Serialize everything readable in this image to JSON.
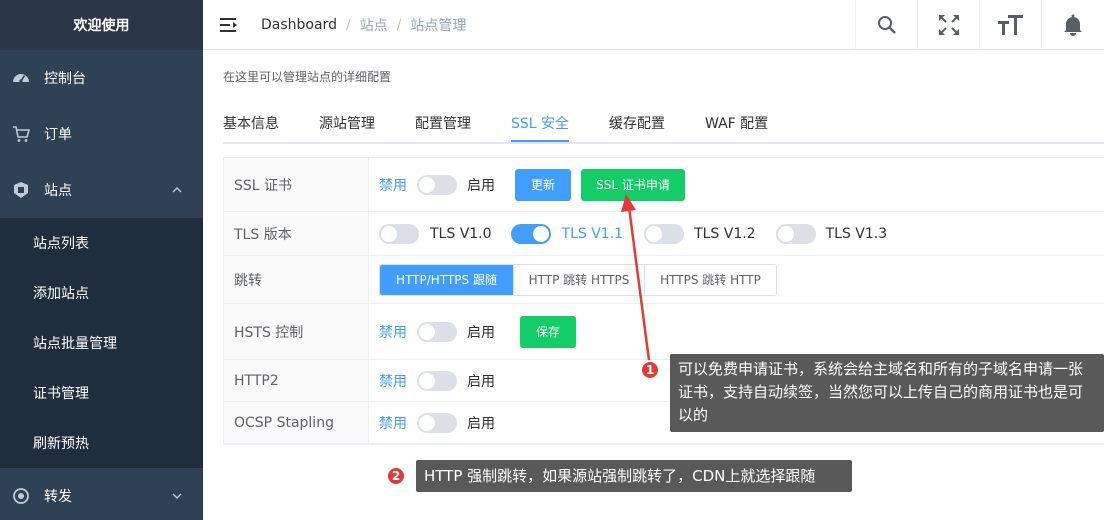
{
  "sidebar": {
    "title": "欢迎使用",
    "items": {
      "dashboard": "控制台",
      "orders": "订单",
      "sites": "站点",
      "forward": "转发"
    },
    "sub_items": [
      "站点列表",
      "添加站点",
      "站点批量管理",
      "证书管理",
      "刷新预热"
    ]
  },
  "breadcrumb": {
    "home": "Dashboard",
    "level1": "站点",
    "level2": "站点管理",
    "separator": "/"
  },
  "page": {
    "description": "在这里可以管理站点的详细配置"
  },
  "tabs": [
    "基本信息",
    "源站管理",
    "配置管理",
    "SSL 安全",
    "缓存配置",
    "WAF 配置"
  ],
  "form": {
    "ssl_cert": {
      "label": "SSL 证书",
      "off": "禁用",
      "on": "启用",
      "update_button": "更新",
      "apply_button": "SSL 证书申请"
    },
    "tls": {
      "label": "TLS 版本",
      "options": [
        "TLS V1.0",
        "TLS V1.1",
        "TLS V1.2",
        "TLS V1.3"
      ]
    },
    "redirect": {
      "label": "跳转",
      "options": [
        "HTTP/HTTPS 跟随",
        "HTTP 跳转 HTTPS",
        "HTTPS 跳转 HTTP"
      ]
    },
    "hsts": {
      "label": "HSTS 控制",
      "off": "禁用",
      "on": "启用",
      "save_button": "保存"
    },
    "http2": {
      "label": "HTTP2",
      "off": "禁用",
      "on": "启用"
    },
    "ocsp": {
      "label": "OCSP Stapling",
      "off": "禁用",
      "on": "启用"
    }
  },
  "annotations": {
    "note1": {
      "number": "1",
      "text": "可以免费申请证书，系统会给主域名和所有的子域名申请一张证书，支持自动续签，当然您可以上传自己的商用证书也是可以的"
    },
    "note2": {
      "number": "2",
      "text": "HTTP 强制跳转，如果源站强制跳转了，CDN上就选择跟随"
    }
  },
  "colors": {
    "sidebar_bg": "#304156",
    "submenu_bg": "#1f2d3d",
    "primary": "#409eff",
    "success": "#13ce66",
    "annotation_arrow": "#e53935",
    "tooltip_bg": "#595959"
  }
}
